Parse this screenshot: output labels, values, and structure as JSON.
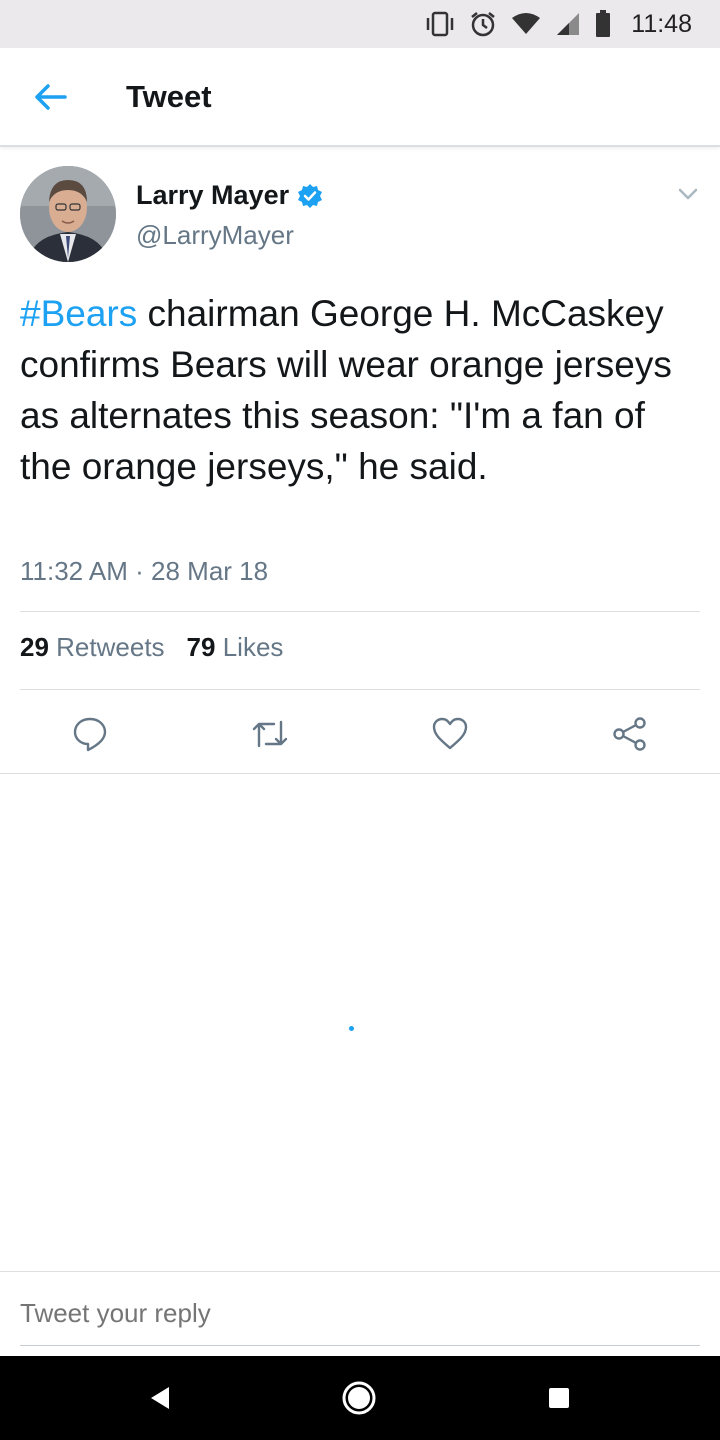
{
  "status_bar": {
    "time": "11:48",
    "icons": [
      "vibrate-icon",
      "alarm-icon",
      "wifi-icon",
      "signal-icon",
      "battery-icon"
    ]
  },
  "app_bar": {
    "title": "Tweet",
    "back_icon": "arrow-left-icon"
  },
  "tweet": {
    "author_name": "Larry Mayer",
    "author_handle": "@LarryMayer",
    "verified": true,
    "hashtag": "#Bears",
    "text": " chairman George H. McCaskey confirms Bears will wear orange jerseys as alternates this season: \"I'm a fan of the orange jerseys,\" he said.",
    "timestamp": "11:32 AM · 28 Mar 18",
    "retweets_count": "29",
    "retweets_label": "Retweets",
    "likes_count": "79",
    "likes_label": "Likes"
  },
  "actions": [
    "reply-icon",
    "retweet-icon",
    "like-icon",
    "share-icon"
  ],
  "reply": {
    "placeholder": "Tweet your reply"
  },
  "colors": {
    "accent": "#1da1f2",
    "secondary_text": "#657786",
    "primary_text": "#14171a"
  }
}
